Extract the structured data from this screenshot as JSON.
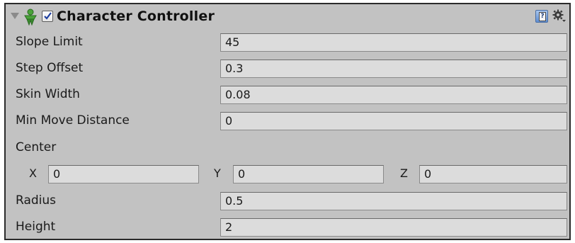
{
  "component": {
    "title": "Character Controller",
    "enabled": true,
    "icons": {
      "fold": "foldout-arrow-icon",
      "component": "character-controller-icon",
      "help": "help-book-icon",
      "settings": "gear-icon"
    }
  },
  "properties": {
    "slope_limit": {
      "label": "Slope Limit",
      "value": "45"
    },
    "step_offset": {
      "label": "Step Offset",
      "value": "0.3"
    },
    "skin_width": {
      "label": "Skin Width",
      "value": "0.08"
    },
    "min_move_distance": {
      "label": "Min Move Distance",
      "value": "0"
    },
    "center": {
      "label": "Center",
      "x": {
        "label": "X",
        "value": "0"
      },
      "y": {
        "label": "Y",
        "value": "0"
      },
      "z": {
        "label": "Z",
        "value": "0"
      }
    },
    "radius": {
      "label": "Radius",
      "value": "0.5"
    },
    "height": {
      "label": "Height",
      "value": "2"
    }
  },
  "colors": {
    "panel_bg": "#c2c2c2",
    "field_bg": "#dcdcdc",
    "border": "#2b2b2b"
  }
}
